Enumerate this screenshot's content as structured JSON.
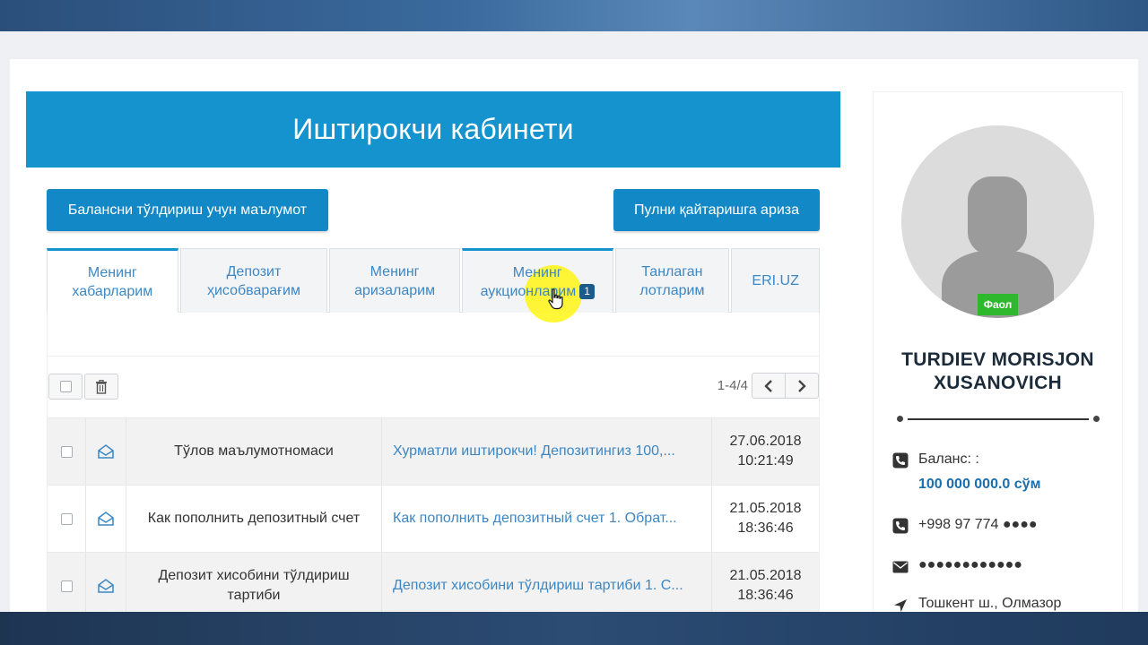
{
  "header": {
    "title": "Иштирокчи кабинети"
  },
  "actions": {
    "balance_info_label": "Балансни тўлдириш учун маълумот",
    "refund_label": "Пулни қайтаришга ариза"
  },
  "tabs": [
    {
      "line1": "Менинг",
      "line2": "хабарларим",
      "active": true
    },
    {
      "line1": "Депозит",
      "line2": "ҳисобварағим"
    },
    {
      "line1": "Менинг",
      "line2": "аризаларим"
    },
    {
      "line1": "Менинг",
      "line2": "аукционларим",
      "badge": "1"
    },
    {
      "line1": "Танлаган",
      "line2": "лотларим"
    },
    {
      "line1": "ERI.UZ",
      "line2": ""
    }
  ],
  "pager": {
    "range": "1-4/4"
  },
  "messages": [
    {
      "title": "Тўлов маълумотномаси",
      "preview": "Хурматли иштирокчи! Депозитингиз 100,...",
      "date": "27.06.2018",
      "time": "10:21:49"
    },
    {
      "title": "Как пополнить депозитный счет",
      "preview": "Как пополнить депозитный счет 1. Обрат...",
      "date": "21.05.2018",
      "time": "18:36:46"
    },
    {
      "title": "Депозит хисобини тўлдириш тартиби",
      "preview": "Депозит хисобини тўлдириш тартиби 1. С...",
      "date": "21.05.2018",
      "time": "18:36:46"
    }
  ],
  "profile": {
    "status": "Фаол",
    "name": "TURDIEV MORISJON XUSANOVICH",
    "balance_label": "Баланс: :",
    "balance_value": "100 000 000.0 сўм",
    "phone": "+998 97 774 ●●●●",
    "email": "●●●●●●●●●●●●",
    "address": "Тошкент ш., Олмазор"
  },
  "colors": {
    "accent": "#1593cf",
    "button": "#1289c6",
    "link": "#3d87c4",
    "status": "#2eb82e"
  }
}
